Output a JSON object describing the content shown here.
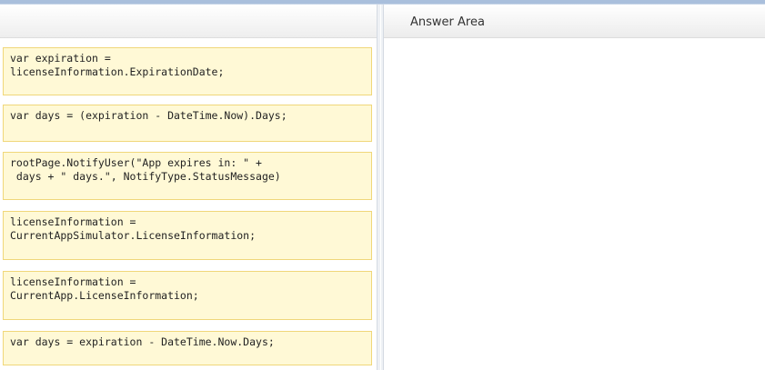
{
  "answer_area": {
    "title": "Answer Area"
  },
  "snippets": [
    "var expiration =\nlicenseInformation.ExpirationDate;",
    "var days = (expiration - DateTime.Now).Days;",
    "rootPage.NotifyUser(\"App expires in: \" +\n days + \" days.\", NotifyType.StatusMessage)",
    "licenseInformation =\nCurrentAppSimulator.LicenseInformation;",
    "licenseInformation =\nCurrentApp.LicenseInformation;",
    "var days = expiration - DateTime.Now.Days;"
  ],
  "colors": {
    "snippet_background": "#fff9d6",
    "snippet_border": "#f0d77a",
    "top_bar": "#a9bfdc"
  }
}
